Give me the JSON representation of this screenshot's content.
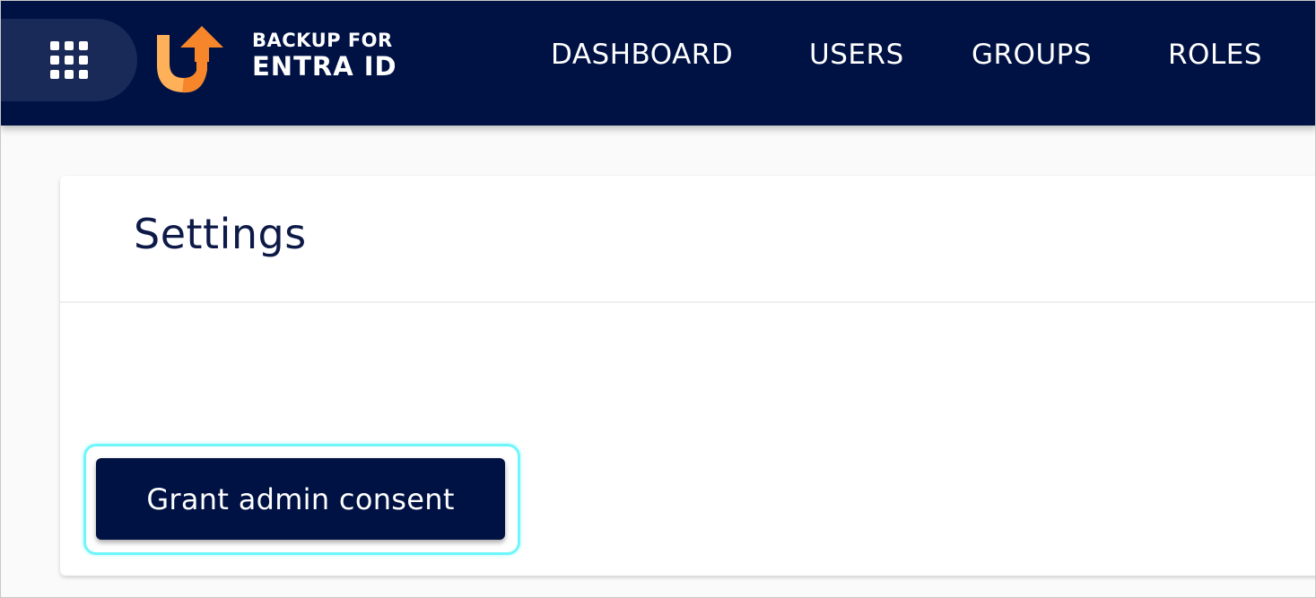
{
  "app": {
    "brand_line1": "BACKUP FOR",
    "brand_line2": "ENTRA ID",
    "logo_icon": "backup-arrow-logo-icon",
    "launcher_icon": "app-grid-icon"
  },
  "nav": {
    "items": [
      {
        "label": "DASHBOARD"
      },
      {
        "label": "USERS"
      },
      {
        "label": "GROUPS"
      },
      {
        "label": "ROLES"
      }
    ]
  },
  "page": {
    "title": "Settings"
  },
  "actions": {
    "grant_consent_label": "Grant admin consent"
  },
  "colors": {
    "topbar_bg": "#001244",
    "launcher_bg": "#192a58",
    "logo_orange_light": "#ffb15a",
    "logo_orange_dark": "#f7862a",
    "focus_ring": "#6ef6fb",
    "title_text": "#0d1a47"
  }
}
